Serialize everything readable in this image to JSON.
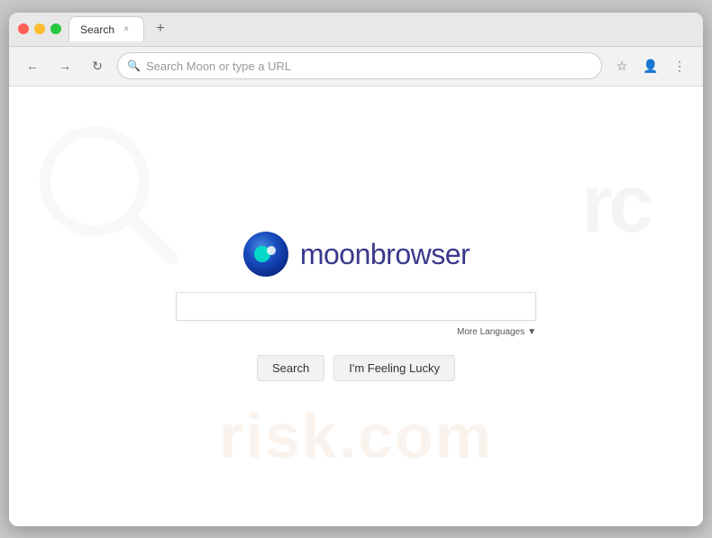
{
  "browser": {
    "tab_title": "Search",
    "address_placeholder": "Search Moon or type a URL",
    "tab_close_icon": "×",
    "tab_new_icon": "+"
  },
  "nav": {
    "back_icon": "←",
    "forward_icon": "→",
    "reload_icon": "↻"
  },
  "page": {
    "brand_name": "moonbrowser",
    "search_input_placeholder": "",
    "more_languages_label": "More Languages",
    "more_languages_arrow": "▼",
    "search_button_label": "Search",
    "lucky_button_label": "I'm Feeling Lucky"
  },
  "watermark": {
    "top_text": "rc",
    "bottom_text": "risk.com"
  }
}
